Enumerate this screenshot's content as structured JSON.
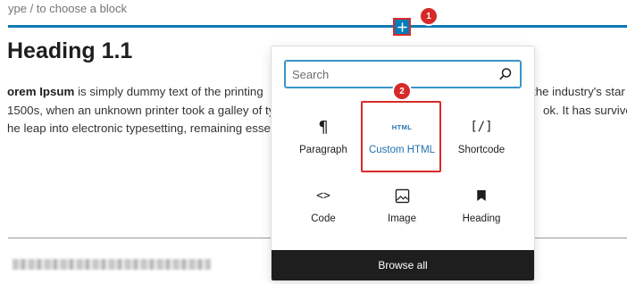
{
  "editor": {
    "placeholder": "ype / to choose a block",
    "heading": "Heading 1.1",
    "paragraph": {
      "bold_start": "orem Ipsum",
      "line1_rest": " is simply dummy text of the printing",
      "line1_right": "the industry's star",
      "line2_left": "1500s, when an unknown printer took a galley of ty",
      "line2_right": "ok. It has survived",
      "line3_left": "he leap into electronic typesetting, remaining esse"
    }
  },
  "inserter": {
    "toggle_icon": "plus-icon",
    "step_1": "1",
    "step_2": "2"
  },
  "popover": {
    "search": {
      "placeholder": "Search",
      "value": ""
    },
    "blocks": [
      {
        "label": "Paragraph",
        "icon": "paragraph-icon",
        "glyph": "¶"
      },
      {
        "label": "Custom HTML",
        "icon": "html-icon",
        "glyph": "HTML"
      },
      {
        "label": "Shortcode",
        "icon": "shortcode-icon",
        "glyph": "[/]"
      },
      {
        "label": "Code",
        "icon": "code-icon",
        "glyph": "<>"
      },
      {
        "label": "Image",
        "icon": "image-icon",
        "glyph": ""
      },
      {
        "label": "Heading",
        "icon": "bookmark-icon",
        "glyph": ""
      }
    ],
    "browse_all": "Browse all"
  },
  "colors": {
    "accent": "#007cba",
    "annotation": "#d92a2a",
    "dark_bar": "#1e1e1e"
  }
}
